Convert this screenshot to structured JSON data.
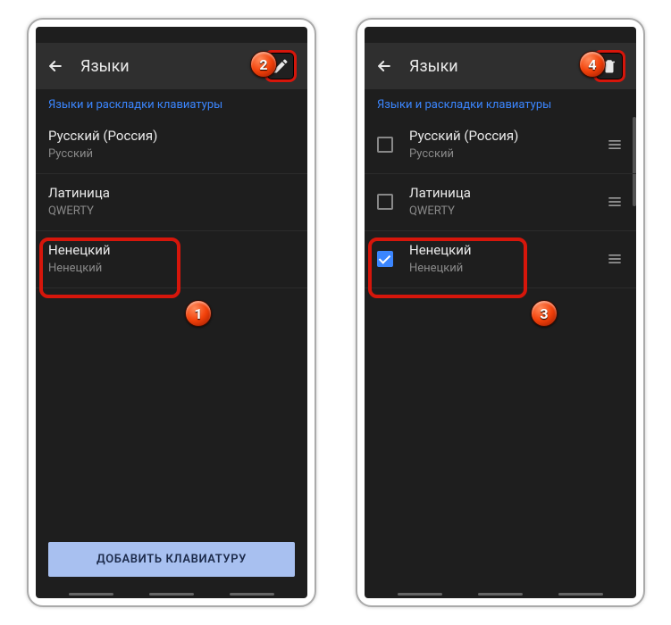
{
  "header": {
    "title": "Языки"
  },
  "section": {
    "title": "Языки и раскладки клавиатуры"
  },
  "languages": [
    {
      "name": "Русский (Россия)",
      "layout": "Русский",
      "checked": false
    },
    {
      "name": "Латиница",
      "layout": "QWERTY",
      "checked": false
    },
    {
      "name": "Ненецкий",
      "layout": "Ненецкий",
      "checked": true
    }
  ],
  "add_button": "ДОБАВИТЬ КЛАВИАТУРУ",
  "badges": {
    "1": "1",
    "2": "2",
    "3": "3",
    "4": "4"
  }
}
